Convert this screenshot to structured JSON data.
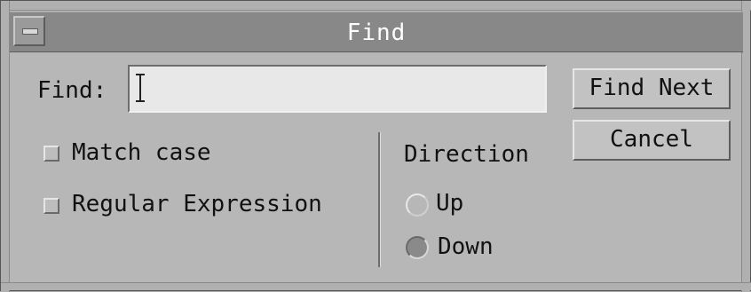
{
  "window": {
    "title": "Find"
  },
  "find": {
    "label": "Find:",
    "value": "",
    "placeholder": ""
  },
  "buttons": {
    "find_next": "Find Next",
    "cancel": "Cancel"
  },
  "options": {
    "match_case": "Match case",
    "regular_expression": "Regular Expression",
    "match_case_checked": false,
    "regular_expression_checked": false
  },
  "direction": {
    "label": "Direction",
    "up": "Up",
    "down": "Down",
    "selected": "Down"
  },
  "colors": {
    "title_bar": "#888888",
    "window_bg": "#b7b7b7",
    "input_bg": "#e8e8e8"
  },
  "icons": {
    "window_menu": "window-menu-icon",
    "text_cursor": "i-beam-cursor-icon"
  }
}
